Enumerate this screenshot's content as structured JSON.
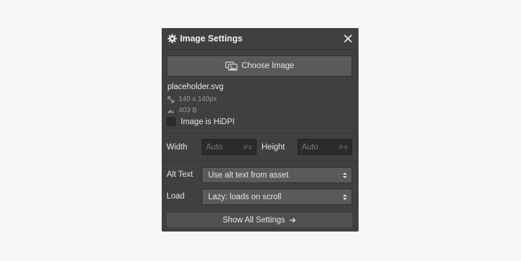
{
  "panel": {
    "title": "Image Settings",
    "choose_label": "Choose Image",
    "file": {
      "name": "placeholder.svg",
      "dimensions": "140 x 140px",
      "size": "403 B"
    },
    "hidpi_label": "Image is HiDPI",
    "hidpi_checked": false,
    "width": {
      "label": "Width",
      "placeholder": "Auto",
      "unit": "PX"
    },
    "height": {
      "label": "Height",
      "placeholder": "Auto",
      "unit": "PX"
    },
    "alt_text": {
      "label": "Alt Text",
      "value": "Use alt text from asset"
    },
    "load": {
      "label": "Load",
      "value": "Lazy: loads on scroll"
    },
    "show_all_label": "Show All Settings"
  },
  "icons": [
    "gear-icon",
    "close-icon",
    "image-icon",
    "resize-icon",
    "gauge-icon",
    "select-arrows-icon",
    "arrow-right-icon"
  ],
  "colors": {
    "panel_bg": "#404040",
    "page_bg": "#f5f6f8",
    "button_bg": "#5a5a5a",
    "input_bg": "#2b2b2b"
  }
}
